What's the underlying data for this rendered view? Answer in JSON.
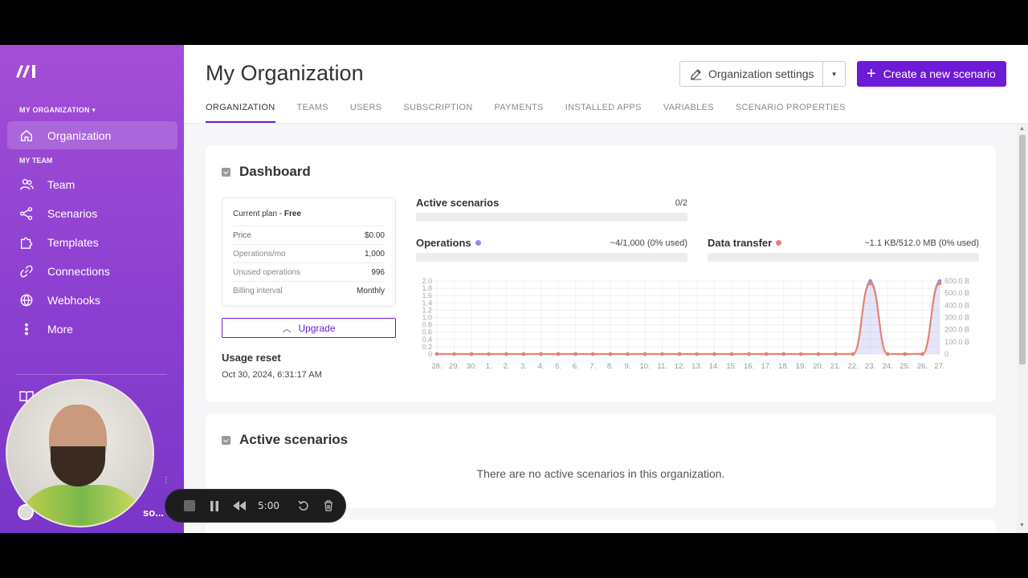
{
  "sidebar": {
    "org_section_label": "MY ORGANIZATION ▾",
    "org_item_label": "Organization",
    "team_section_label": "MY TEAM",
    "items": [
      {
        "label": "Team",
        "icon": "team-icon"
      },
      {
        "label": "Scenarios",
        "icon": "share-icon"
      },
      {
        "label": "Templates",
        "icon": "puzzle-icon"
      },
      {
        "label": "Connections",
        "icon": "link-icon"
      },
      {
        "label": "Webhooks",
        "icon": "globe-icon"
      },
      {
        "label": "More",
        "icon": "more-icon"
      }
    ],
    "user_name": "so..."
  },
  "recorder": {
    "time": "5:00"
  },
  "header": {
    "title": "My Organization",
    "settings_label": "Organization settings",
    "create_label": "Create a new scenario",
    "tabs": [
      "ORGANIZATION",
      "TEAMS",
      "USERS",
      "SUBSCRIPTION",
      "PAYMENTS",
      "INSTALLED APPS",
      "VARIABLES",
      "SCENARIO PROPERTIES"
    ],
    "active_tab": "ORGANIZATION"
  },
  "dashboard": {
    "title": "Dashboard",
    "plan": {
      "title_prefix": "Current plan - ",
      "title_plan": "Free",
      "rows": [
        {
          "key": "Price",
          "value": "$0.00"
        },
        {
          "key": "Operations/mo",
          "value": "1,000"
        },
        {
          "key": "Unused operations",
          "value": "996"
        },
        {
          "key": "Billing interval",
          "value": "Monthly"
        }
      ]
    },
    "upgrade_label": "Upgrade",
    "usage_reset_title": "Usage reset",
    "usage_reset_date": "Oct 30, 2024, 6:31:17 AM",
    "active_scenarios": {
      "label": "Active scenarios",
      "value": "0/2",
      "fraction": 0
    },
    "operations": {
      "label": "Operations",
      "value": "~4/1,000 (0% used)",
      "fraction": 0.004,
      "color": "#8b8be8"
    },
    "data_transfer": {
      "label": "Data transfer",
      "value": "~1.1 KB/512.0 MB (0% used)",
      "fraction": 0,
      "color": "#e8806e"
    }
  },
  "chart_data": {
    "type": "line",
    "x": [
      "28.",
      "29.",
      "30.",
      "1.",
      "2.",
      "3.",
      "4.",
      "5.",
      "6.",
      "7.",
      "8.",
      "9.",
      "10.",
      "11.",
      "12.",
      "13.",
      "14.",
      "15.",
      "16.",
      "17.",
      "18.",
      "19.",
      "20.",
      "21.",
      "22.",
      "23.",
      "24.",
      "25.",
      "26.",
      "27."
    ],
    "y_left_ticks": [
      "2.0",
      "1.8",
      "1.6",
      "1.4",
      "1.2",
      "1.0",
      "0.8",
      "0.6",
      "0.4",
      "0.2",
      "0"
    ],
    "y_right_ticks": [
      "600.0 B",
      "500.0 B",
      "400.0 B",
      "300.0 B",
      "200.0 B",
      "100.0 B",
      "0"
    ],
    "ylim_left": [
      0,
      2.0
    ],
    "ylim_right": [
      0,
      600
    ],
    "series": [
      {
        "name": "Operations",
        "axis": "left",
        "color": "#8b8be8",
        "values": [
          0,
          0,
          0,
          0,
          0,
          0,
          0,
          0,
          0,
          0,
          0,
          0,
          0,
          0,
          0,
          0,
          0,
          0,
          0,
          0,
          0,
          0,
          0,
          0,
          0,
          2,
          0,
          0,
          0,
          2
        ]
      },
      {
        "name": "Data transfer",
        "axis": "right",
        "color": "#e8806e",
        "values": [
          0,
          0,
          0,
          0,
          0,
          0,
          0,
          0,
          0,
          0,
          0,
          0,
          0,
          0,
          0,
          0,
          0,
          0,
          0,
          0,
          0,
          0,
          0,
          0,
          0,
          580,
          0,
          0,
          0,
          580
        ]
      }
    ],
    "grid": true
  },
  "active_scenarios_card": {
    "title": "Active scenarios",
    "empty_text": "There are no active scenarios in this organization."
  }
}
